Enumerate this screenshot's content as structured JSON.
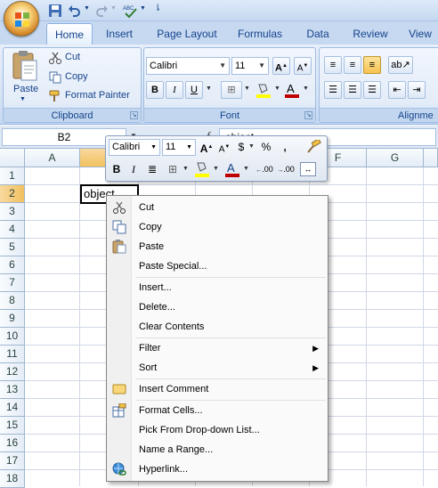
{
  "tabs": [
    "Home",
    "Insert",
    "Page Layout",
    "Formulas",
    "Data",
    "Review",
    "View"
  ],
  "clipboard": {
    "paste": "Paste",
    "cut": "Cut",
    "copy": "Copy",
    "format_painter": "Format Painter",
    "label": "Clipboard"
  },
  "font": {
    "family": "Calibri",
    "size": "11",
    "label": "Font"
  },
  "alignment": {
    "label": "Alignme"
  },
  "formula_bar": {
    "name_box": "B2",
    "fx": "f",
    "value": "object"
  },
  "columns": [
    "A",
    "B",
    "C",
    "D",
    "E",
    "F",
    "G"
  ],
  "rows": [
    "1",
    "2",
    "3",
    "4",
    "5",
    "6",
    "7",
    "8",
    "9",
    "10",
    "11",
    "12",
    "13",
    "14",
    "15",
    "16",
    "17",
    "18"
  ],
  "cell_b2": "object",
  "mini_toolbar": {
    "font": "Calibri",
    "size": "11",
    "currency": "$",
    "percent": "%",
    "comma": ",",
    "inc_dec": ".00",
    "dec_dec": ".00"
  },
  "context_menu": {
    "cut": "Cut",
    "copy": "Copy",
    "paste": "Paste",
    "paste_special": "Paste Special...",
    "insert": "Insert...",
    "delete": "Delete...",
    "clear_contents": "Clear Contents",
    "filter": "Filter",
    "sort": "Sort",
    "insert_comment": "Insert Comment",
    "format_cells": "Format Cells...",
    "pick_list": "Pick From Drop-down List...",
    "name_range": "Name a Range...",
    "hyperlink": "Hyperlink..."
  },
  "colors": {
    "ribbon_text": "#15428b",
    "selected_header": "#f1c15f",
    "accent_red": "#c00000",
    "highlight_yellow": "#ffff00"
  }
}
